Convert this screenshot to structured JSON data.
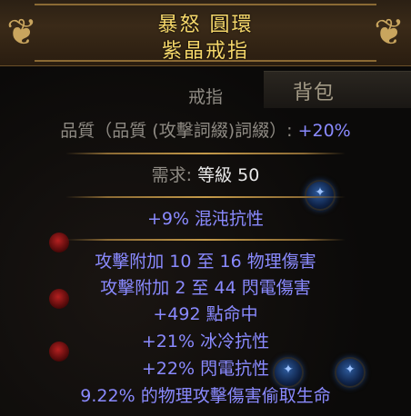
{
  "item": {
    "name": "暴怒 圓環",
    "base_type": "紫晶戒指",
    "item_class": "戒指",
    "quality_label": "品質（品質 (攻擊詞綴)詞綴）: ",
    "quality_value": "+20%",
    "requirements_label": "需求: ",
    "requirements_value": "等級 50",
    "implicit_mod": "+9% 混沌抗性",
    "explicit_mods": [
      "攻擊附加 10 至 16 物理傷害",
      "攻擊附加 2 至 44 閃電傷害",
      "+492 點命中",
      "+21% 冰冷抗性",
      "+22% 閃電抗性",
      "9.22% 的物理攻擊傷害偷取生命"
    ]
  },
  "background": {
    "tab_label": "背包"
  },
  "colors": {
    "unique_title": "#f5d76a",
    "magic_mod": "#8a8aff",
    "label_grey": "#8e8a83",
    "separator": "#c49a4a"
  }
}
